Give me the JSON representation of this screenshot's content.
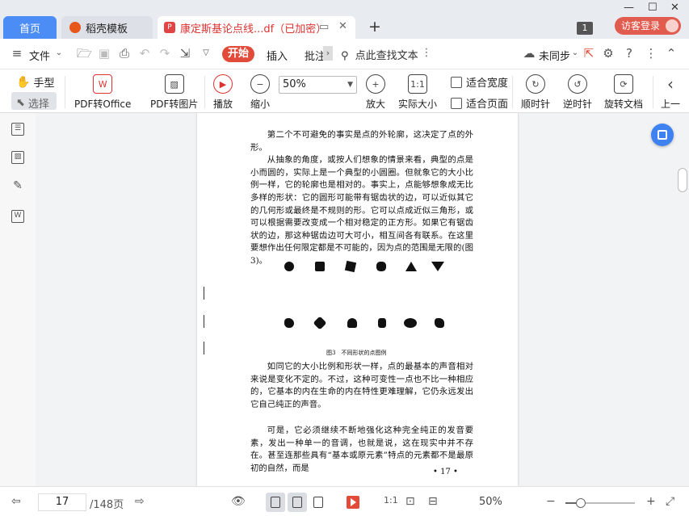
{
  "tabs": {
    "home": "首页",
    "template": "稻壳模板",
    "document": "康定斯基论点线...df（已加密）",
    "count_badge": "1",
    "login": "访客登录"
  },
  "menu": {
    "file": "文件",
    "start": "开始",
    "insert": "插入",
    "annotate": "批注",
    "search": "点此查找文本",
    "sync": "未同步"
  },
  "ribbon": {
    "hand": "手型",
    "select": "选择",
    "pdf_to_office": "PDF转Office",
    "pdf_to_image": "PDF转图片",
    "play": "播放",
    "zoom_out": "缩小",
    "zoom_value": "50%",
    "zoom_in": "放大",
    "actual_size": "实际大小",
    "fit_width": "适合宽度",
    "fit_page": "适合页面",
    "rotate_cw": "顺时针",
    "rotate_ccw": "逆时针",
    "rotate_doc": "旋转文档",
    "prev": "上一"
  },
  "document": {
    "para1": [
      "第二个不可避免的事实是点的外轮廓，这决定了点的外形。",
      "从抽象的角度，或按人们想象的情景来看，典型的点是小而圆的，实际上是一个典型的小圆圈。但就象它的大小比例一样，它的轮廓也是相对的。事实上，点能够想象成无比多样的形状：它的圆形可能带有锯齿状的边，可以近似其它的几何形或最终是不规则的形。它可以点成近似三角形，或可以根据需要改变成一个相对稳定的正方形。如果它有锯齿状的边，那这种锯齿边可大可小，相互间各有联系。在这里要想作出任何限定都是不可能的，因为点的范围是无限的(图3)。"
    ],
    "figure_caption": "图3　不同形状的点图例",
    "para2": "如同它的大小比例和形状一样，点的最基本的声音相对来说是变化不定的。不过，这种可变性一点也不比一种相应的，它基本的内在生命的内在特性更难理解，它仍永远发出它自己纯正的声音。",
    "para3": "可是，它必须继续不断地强化这种完全纯正的发音要素，发出一种单一的音调，也就是说，这在现实中并不存在。甚至连那些具有“基本或原元素”特点的元素都不是最原初的自然，而是",
    "page_number": "• 17 •"
  },
  "status": {
    "current_page": "17",
    "total_pages": "/148页",
    "zoom_percent": "50%",
    "zoom_level": 0.22
  }
}
